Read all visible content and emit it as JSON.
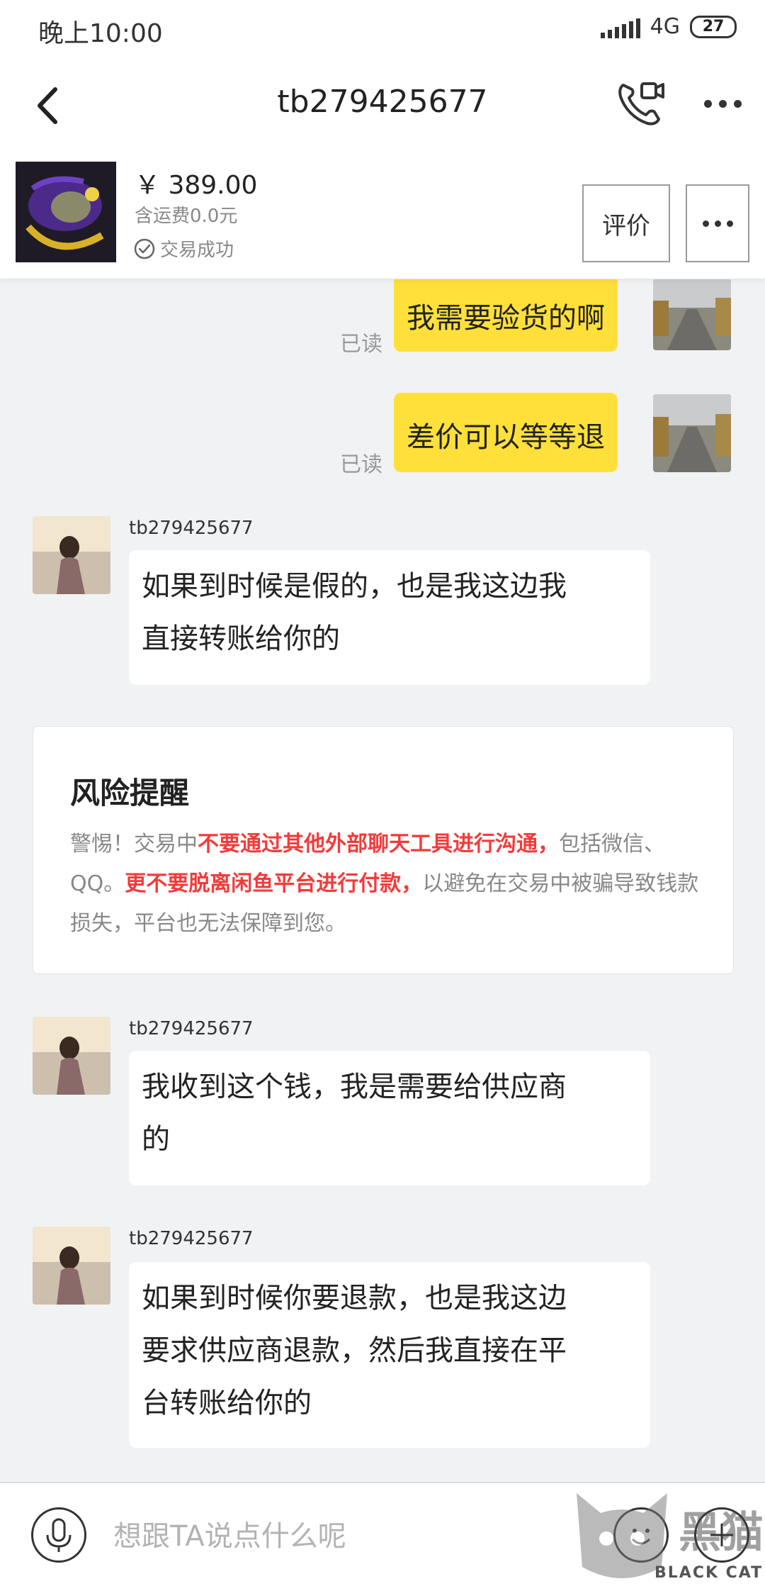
{
  "status_bar": {
    "time": "晚上10:00",
    "network": "4G",
    "battery": "27"
  },
  "header": {
    "title": "tb279425677",
    "back_icon": "chevron-left-icon",
    "call_icon": "video-call-icon",
    "more_icon": "more-horizontal-icon"
  },
  "product": {
    "price": "￥ 389.00",
    "shipping": "含运费0.0元",
    "status": "交易成功",
    "rate_label": "评价"
  },
  "messages": {
    "out_1": {
      "text": "我需要验货的啊",
      "read": "已读"
    },
    "out_2": {
      "text": "差价可以等等退",
      "read": "已读"
    },
    "in_1": {
      "sender": "tb279425677",
      "line1": "如果到时候是假的，也是我这边我",
      "line2": "直接转账给你的"
    },
    "in_2": {
      "sender": "tb279425677",
      "line1": "我收到这个钱，我是需要给供应商",
      "line2": "的"
    },
    "in_3": {
      "sender": "tb279425677",
      "line1": "如果到时候你要退款，也是我这边",
      "line2": "要求供应商退款，然后我直接在平",
      "line3": "台转账给你的"
    }
  },
  "risk": {
    "title": "风险提醒",
    "p1": "警惕！交易中",
    "p2": "不要通过其他外部聊天工具进行沟通，",
    "p3": "包括微信、QQ。",
    "p4": "更不要脱离闲鱼平台进行付款，",
    "p5": "以避免在交易中被骗导致钱款损失，平台也无法保障到您。"
  },
  "input": {
    "placeholder": "想跟TA说点什么呢"
  },
  "watermark": {
    "text": "BLACK CAT",
    "logo_text": "黑猫"
  },
  "colors": {
    "accent_yellow": "#ffe03a",
    "warning_red": "#f43a3a",
    "background": "#f1f2f4"
  }
}
